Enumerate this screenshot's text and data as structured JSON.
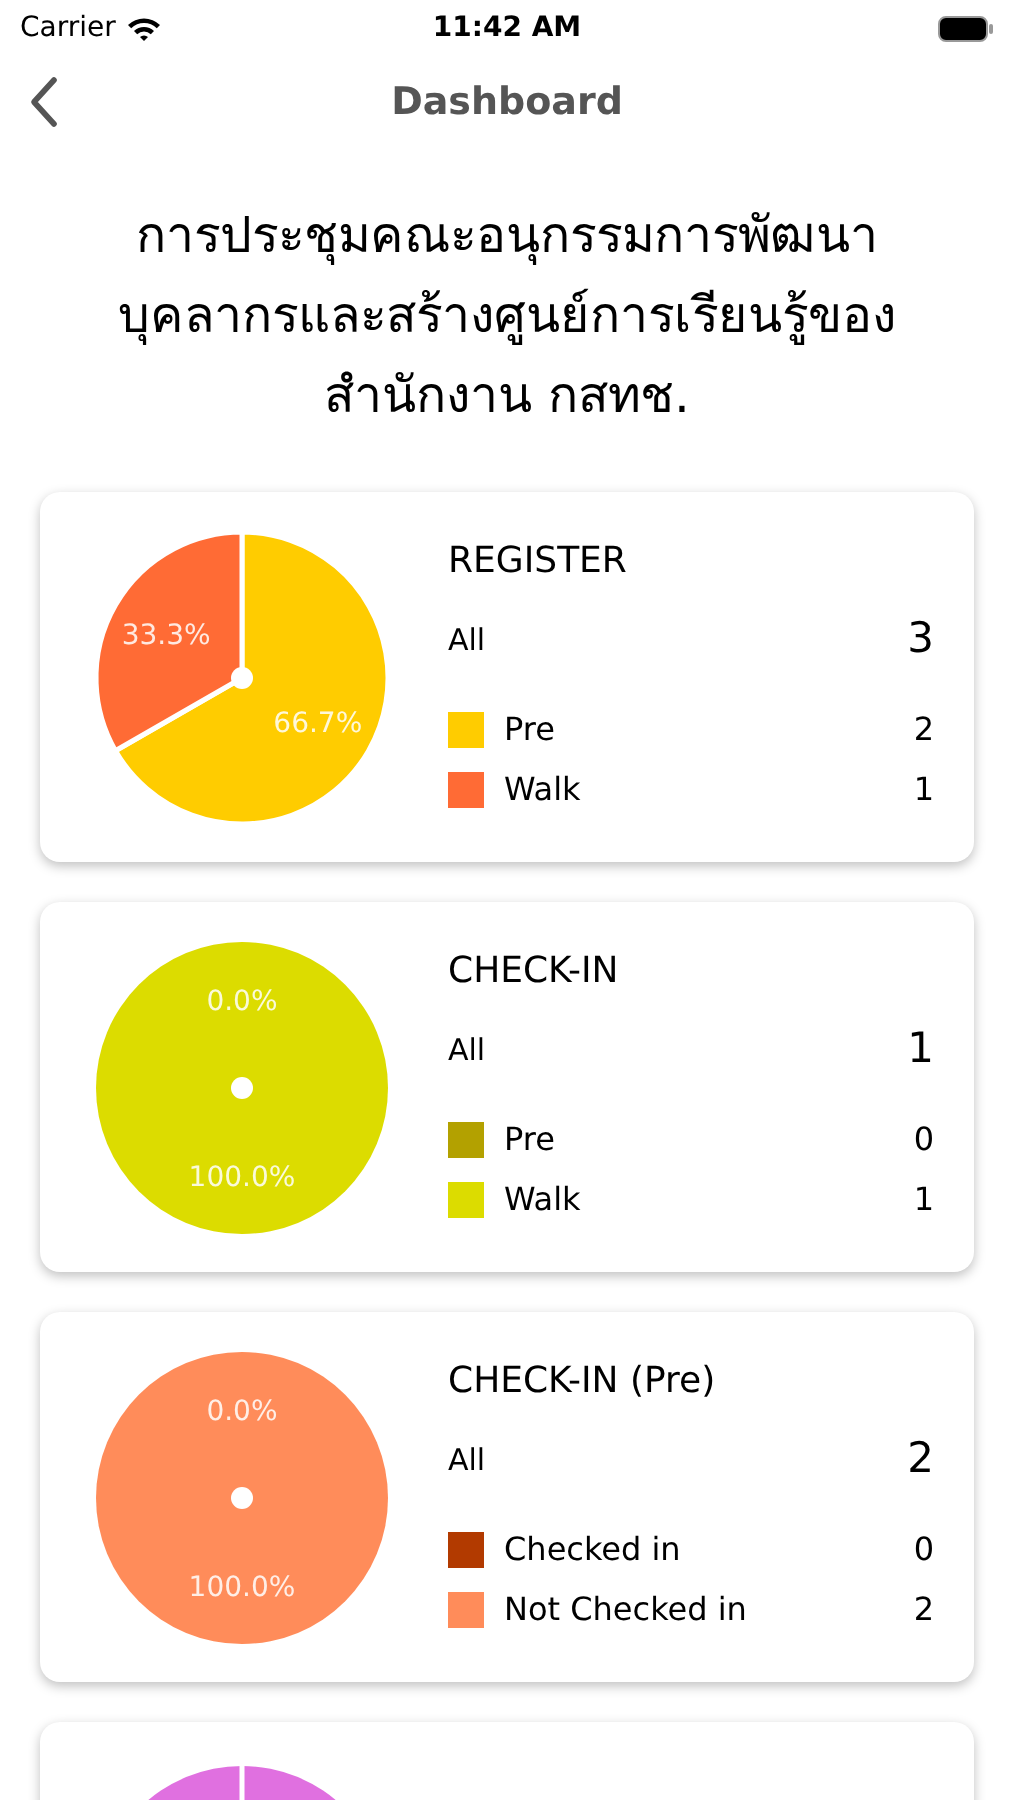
{
  "status_bar": {
    "carrier": "Carrier",
    "time": "11:42 AM"
  },
  "nav": {
    "title": "Dashboard"
  },
  "heading": "การประชุมคณะอนุกรรมการพัฒนาบุคลากรและสร้างศูนย์การเรียนรู้ของสำนักงาน กสทช.",
  "cards": [
    {
      "title": "REGISTER",
      "total_label": "All",
      "total": "3",
      "legend": [
        {
          "label": "Pre",
          "count": "2",
          "color": "#ffcc00"
        },
        {
          "label": "Walk",
          "count": "1",
          "color": "#ff6b35"
        }
      ],
      "chart_data": {
        "type": "pie",
        "values": [
          66.7,
          33.3
        ],
        "value_labels": [
          "66.7%",
          "33.3%"
        ]
      }
    },
    {
      "title": "CHECK-IN",
      "total_label": "All",
      "total": "1",
      "legend": [
        {
          "label": "Pre",
          "count": "0",
          "color": "#b3a100"
        },
        {
          "label": "Walk",
          "count": "1",
          "color": "#dcdc00"
        }
      ],
      "chart_data": {
        "type": "pie",
        "values": [
          0,
          100
        ],
        "value_labels": [
          "0.0%",
          "100.0%"
        ]
      }
    },
    {
      "title": "CHECK-IN (Pre)",
      "total_label": "All",
      "total": "2",
      "legend": [
        {
          "label": "Checked in",
          "count": "0",
          "color": "#b23a00"
        },
        {
          "label": "Not Checked in",
          "count": "2",
          "color": "#ff8c5a"
        }
      ],
      "chart_data": {
        "type": "pie",
        "values": [
          0,
          100
        ],
        "value_labels": [
          "0.0%",
          "100.0%"
        ]
      }
    }
  ]
}
